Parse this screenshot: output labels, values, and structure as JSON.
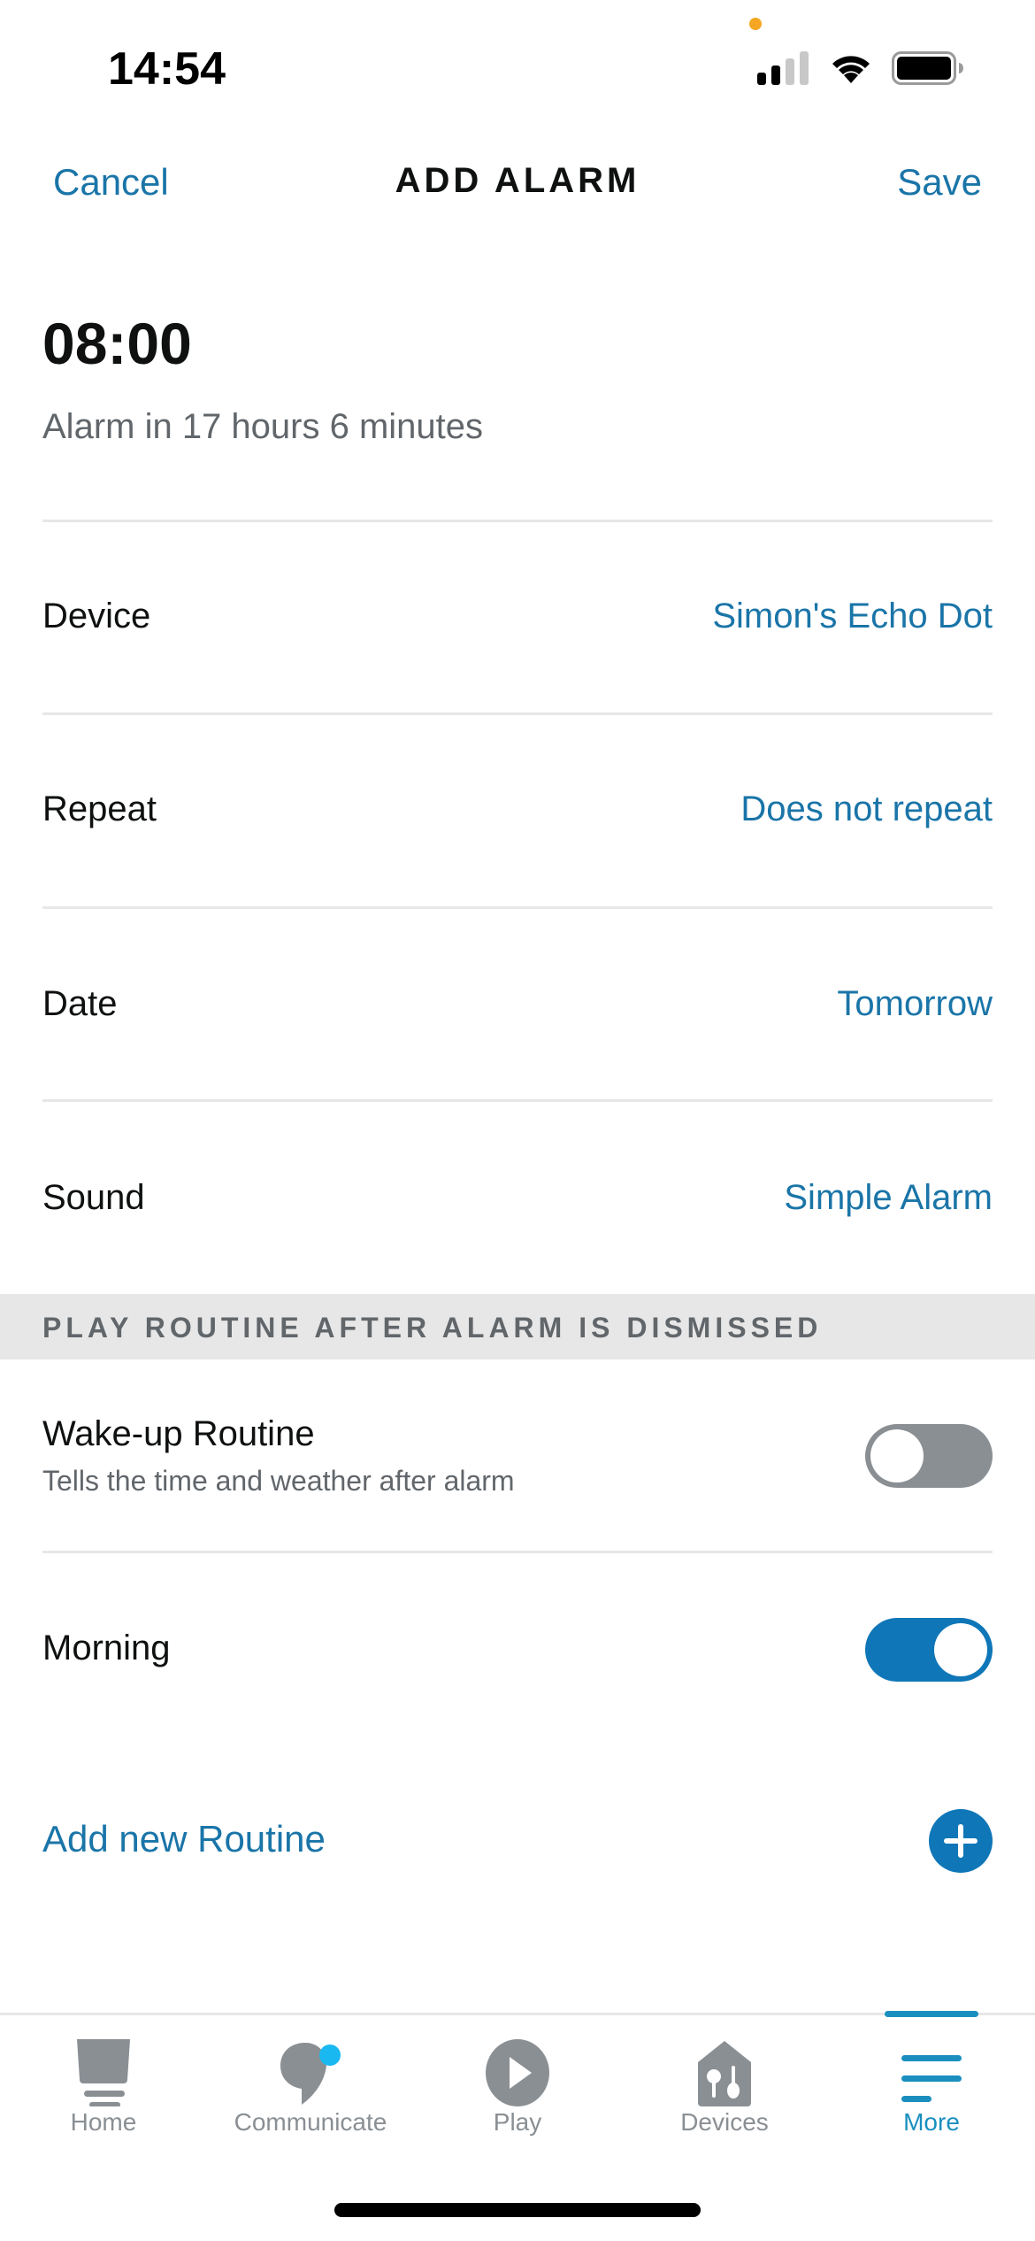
{
  "status_bar": {
    "time": "14:54",
    "icons": [
      "privacy-indicator-dot",
      "cellular-signal-icon",
      "wifi-icon",
      "battery-icon"
    ],
    "signal_bars_active": 2,
    "signal_bars_total": 4
  },
  "nav": {
    "cancel_label": "Cancel",
    "title": "ADD ALARM",
    "save_label": "Save"
  },
  "alarm": {
    "time": "08:00",
    "countdown": "Alarm in 17 hours 6 minutes"
  },
  "settings": [
    {
      "label": "Device",
      "value": "Simon's Echo Dot"
    },
    {
      "label": "Repeat",
      "value": "Does not repeat"
    },
    {
      "label": "Date",
      "value": "Tomorrow"
    },
    {
      "label": "Sound",
      "value": "Simple Alarm"
    }
  ],
  "routines_section": {
    "header": "PLAY ROUTINE AFTER ALARM IS DISMISSED",
    "routines": [
      {
        "title": "Wake-up Routine",
        "subtitle": "Tells the time and weather after alarm",
        "enabled": false
      },
      {
        "title": "Morning",
        "subtitle": "",
        "enabled": true
      }
    ],
    "add_label": "Add new Routine"
  },
  "tab_bar": {
    "tabs": [
      {
        "label": "Home",
        "icon": "home-echo-icon",
        "active": false
      },
      {
        "label": "Communicate",
        "icon": "chat-bubble-icon",
        "active": false,
        "badge": true
      },
      {
        "label": "Play",
        "icon": "play-circle-icon",
        "active": false
      },
      {
        "label": "Devices",
        "icon": "devices-house-icon",
        "active": false
      },
      {
        "label": "More",
        "icon": "menu-lines-icon",
        "active": true
      }
    ]
  },
  "colors": {
    "accent": "#1a75a8",
    "toggle_on": "#0f76b8",
    "toggle_off": "#8a8f94",
    "tab_active": "#1a8fbf",
    "tab_inactive": "#8a8f94",
    "badge": "#1ab8f0",
    "section_bg": "#e7e7e7"
  }
}
